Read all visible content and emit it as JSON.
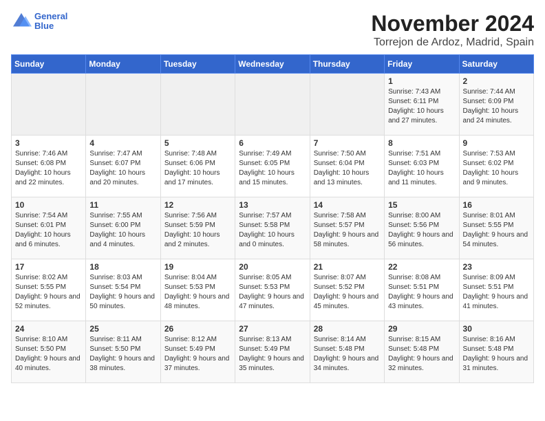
{
  "header": {
    "logo_line1": "General",
    "logo_line2": "Blue",
    "title": "November 2024",
    "location": "Torrejon de Ardoz, Madrid, Spain"
  },
  "days_of_week": [
    "Sunday",
    "Monday",
    "Tuesday",
    "Wednesday",
    "Thursday",
    "Friday",
    "Saturday"
  ],
  "weeks": [
    [
      {
        "day": "",
        "data": ""
      },
      {
        "day": "",
        "data": ""
      },
      {
        "day": "",
        "data": ""
      },
      {
        "day": "",
        "data": ""
      },
      {
        "day": "",
        "data": ""
      },
      {
        "day": "1",
        "data": "Sunrise: 7:43 AM\nSunset: 6:11 PM\nDaylight: 10 hours and 27 minutes."
      },
      {
        "day": "2",
        "data": "Sunrise: 7:44 AM\nSunset: 6:09 PM\nDaylight: 10 hours and 24 minutes."
      }
    ],
    [
      {
        "day": "3",
        "data": "Sunrise: 7:46 AM\nSunset: 6:08 PM\nDaylight: 10 hours and 22 minutes."
      },
      {
        "day": "4",
        "data": "Sunrise: 7:47 AM\nSunset: 6:07 PM\nDaylight: 10 hours and 20 minutes."
      },
      {
        "day": "5",
        "data": "Sunrise: 7:48 AM\nSunset: 6:06 PM\nDaylight: 10 hours and 17 minutes."
      },
      {
        "day": "6",
        "data": "Sunrise: 7:49 AM\nSunset: 6:05 PM\nDaylight: 10 hours and 15 minutes."
      },
      {
        "day": "7",
        "data": "Sunrise: 7:50 AM\nSunset: 6:04 PM\nDaylight: 10 hours and 13 minutes."
      },
      {
        "day": "8",
        "data": "Sunrise: 7:51 AM\nSunset: 6:03 PM\nDaylight: 10 hours and 11 minutes."
      },
      {
        "day": "9",
        "data": "Sunrise: 7:53 AM\nSunset: 6:02 PM\nDaylight: 10 hours and 9 minutes."
      }
    ],
    [
      {
        "day": "10",
        "data": "Sunrise: 7:54 AM\nSunset: 6:01 PM\nDaylight: 10 hours and 6 minutes."
      },
      {
        "day": "11",
        "data": "Sunrise: 7:55 AM\nSunset: 6:00 PM\nDaylight: 10 hours and 4 minutes."
      },
      {
        "day": "12",
        "data": "Sunrise: 7:56 AM\nSunset: 5:59 PM\nDaylight: 10 hours and 2 minutes."
      },
      {
        "day": "13",
        "data": "Sunrise: 7:57 AM\nSunset: 5:58 PM\nDaylight: 10 hours and 0 minutes."
      },
      {
        "day": "14",
        "data": "Sunrise: 7:58 AM\nSunset: 5:57 PM\nDaylight: 9 hours and 58 minutes."
      },
      {
        "day": "15",
        "data": "Sunrise: 8:00 AM\nSunset: 5:56 PM\nDaylight: 9 hours and 56 minutes."
      },
      {
        "day": "16",
        "data": "Sunrise: 8:01 AM\nSunset: 5:55 PM\nDaylight: 9 hours and 54 minutes."
      }
    ],
    [
      {
        "day": "17",
        "data": "Sunrise: 8:02 AM\nSunset: 5:55 PM\nDaylight: 9 hours and 52 minutes."
      },
      {
        "day": "18",
        "data": "Sunrise: 8:03 AM\nSunset: 5:54 PM\nDaylight: 9 hours and 50 minutes."
      },
      {
        "day": "19",
        "data": "Sunrise: 8:04 AM\nSunset: 5:53 PM\nDaylight: 9 hours and 48 minutes."
      },
      {
        "day": "20",
        "data": "Sunrise: 8:05 AM\nSunset: 5:53 PM\nDaylight: 9 hours and 47 minutes."
      },
      {
        "day": "21",
        "data": "Sunrise: 8:07 AM\nSunset: 5:52 PM\nDaylight: 9 hours and 45 minutes."
      },
      {
        "day": "22",
        "data": "Sunrise: 8:08 AM\nSunset: 5:51 PM\nDaylight: 9 hours and 43 minutes."
      },
      {
        "day": "23",
        "data": "Sunrise: 8:09 AM\nSunset: 5:51 PM\nDaylight: 9 hours and 41 minutes."
      }
    ],
    [
      {
        "day": "24",
        "data": "Sunrise: 8:10 AM\nSunset: 5:50 PM\nDaylight: 9 hours and 40 minutes."
      },
      {
        "day": "25",
        "data": "Sunrise: 8:11 AM\nSunset: 5:50 PM\nDaylight: 9 hours and 38 minutes."
      },
      {
        "day": "26",
        "data": "Sunrise: 8:12 AM\nSunset: 5:49 PM\nDaylight: 9 hours and 37 minutes."
      },
      {
        "day": "27",
        "data": "Sunrise: 8:13 AM\nSunset: 5:49 PM\nDaylight: 9 hours and 35 minutes."
      },
      {
        "day": "28",
        "data": "Sunrise: 8:14 AM\nSunset: 5:48 PM\nDaylight: 9 hours and 34 minutes."
      },
      {
        "day": "29",
        "data": "Sunrise: 8:15 AM\nSunset: 5:48 PM\nDaylight: 9 hours and 32 minutes."
      },
      {
        "day": "30",
        "data": "Sunrise: 8:16 AM\nSunset: 5:48 PM\nDaylight: 9 hours and 31 minutes."
      }
    ]
  ]
}
